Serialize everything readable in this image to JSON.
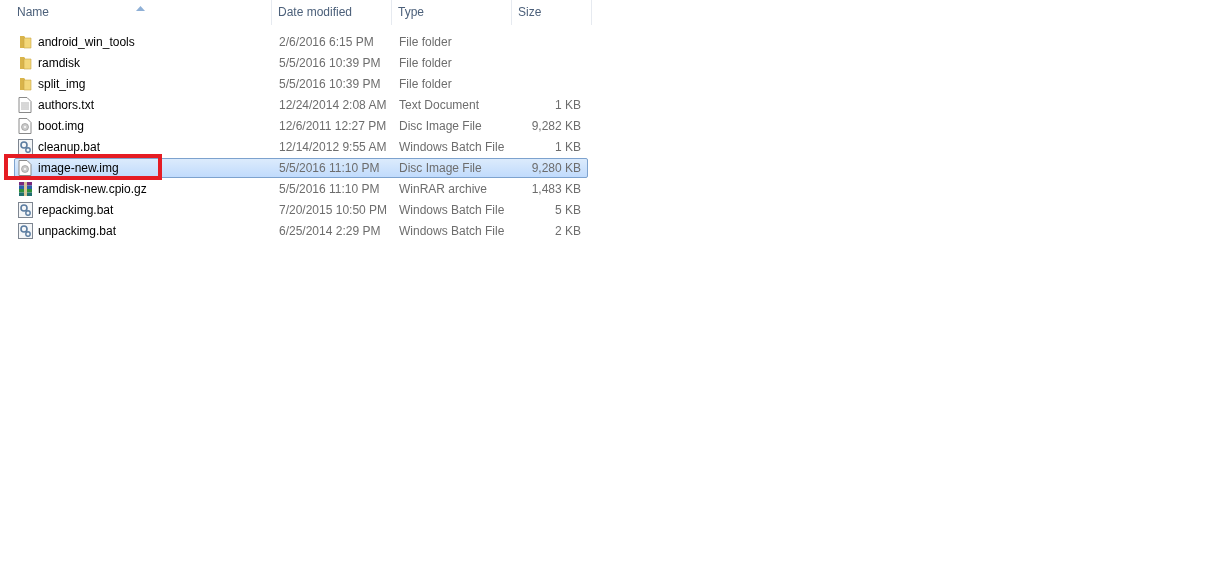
{
  "columns": [
    {
      "label": "Name",
      "sorted": true
    },
    {
      "label": "Date modified",
      "sorted": false
    },
    {
      "label": "Type",
      "sorted": false
    },
    {
      "label": "Size",
      "sorted": false
    }
  ],
  "rows": [
    {
      "kind": "folder",
      "name": "android_win_tools",
      "date": "2/6/2016 6:15 PM",
      "type": "File folder",
      "selected": false,
      "highlighted": false
    },
    {
      "kind": "folder",
      "name": "ramdisk",
      "date": "5/5/2016 10:39 PM",
      "type": "File folder",
      "selected": false,
      "highlighted": false
    },
    {
      "kind": "folder",
      "name": "split_img",
      "date": "5/5/2016 10:39 PM",
      "type": "File folder",
      "selected": false,
      "highlighted": false
    },
    {
      "kind": "text",
      "name": "authors.txt",
      "date": "12/24/2014 2:08 AM",
      "type": "Text Document",
      "size": "1 KB",
      "selected": false,
      "highlighted": false
    },
    {
      "kind": "disc",
      "name": "boot.img",
      "date": "12/6/2011 12:27 PM",
      "type": "Disc Image File",
      "size": "9,282 KB",
      "selected": false,
      "highlighted": false
    },
    {
      "kind": "batch",
      "name": "cleanup.bat",
      "date": "12/14/2012 9:55 AM",
      "type": "Windows Batch File",
      "size": "1 KB",
      "selected": false,
      "highlighted": false
    },
    {
      "kind": "disc",
      "name": "image-new.img",
      "date": "5/5/2016 11:10 PM",
      "type": "Disc Image File",
      "size": "9,280 KB",
      "selected": true,
      "highlighted": true
    },
    {
      "kind": "archive",
      "name": "ramdisk-new.cpio.gz",
      "date": "5/5/2016 11:10 PM",
      "type": "WinRAR archive",
      "size": "1,483 KB",
      "selected": false,
      "highlighted": false
    },
    {
      "kind": "batch",
      "name": "repackimg.bat",
      "date": "7/20/2015 10:50 PM",
      "type": "Windows Batch File",
      "size": "5 KB",
      "selected": false,
      "highlighted": false
    },
    {
      "kind": "batch",
      "name": "unpackimg.bat",
      "date": "6/25/2014 2:29 PM",
      "type": "Windows Batch File",
      "size": "2 KB",
      "selected": false,
      "highlighted": false
    }
  ]
}
